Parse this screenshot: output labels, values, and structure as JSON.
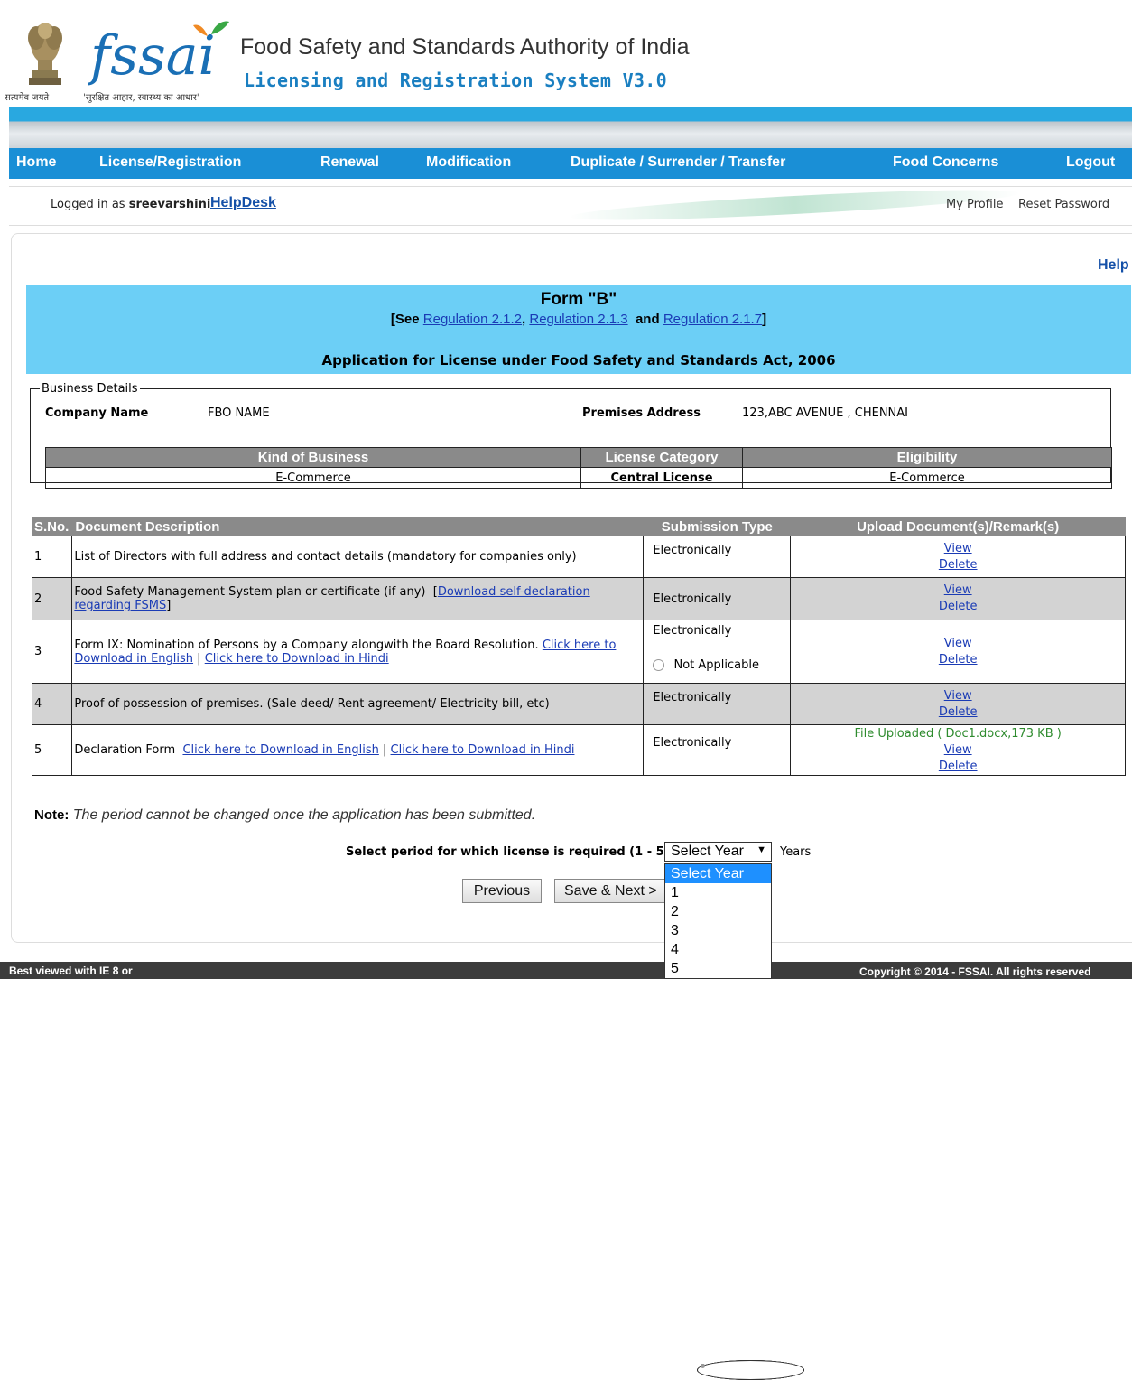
{
  "header": {
    "org_name": "Food Safety and Standards Authority of India",
    "system_name": "Licensing and Registration System V3.0",
    "emblem_caption": "सत्यमेव जयते",
    "logo_text": "fssai",
    "logo_tagline": "'सुरक्षित आहार, स्वास्थ्य का आधार'"
  },
  "nav": {
    "items": [
      "Home",
      "License/Registration",
      "Renewal",
      "Modification",
      "Duplicate / Surrender / Transfer",
      "Food Concerns",
      "Logout"
    ]
  },
  "subbar": {
    "logged_in_prefix": "Logged in as",
    "username": "sreevarshini",
    "helpdesk": "HelpDesk",
    "my_profile": "My Profile",
    "reset_password": "Reset Password"
  },
  "help_link": "Help",
  "form": {
    "title": "Form \"B\"",
    "see_prefix": "[See",
    "reg1": "Regulation 2.1.2",
    "comma": ",",
    "reg2": "Regulation 2.1.3",
    "and_text": "and",
    "reg3": "Regulation 2.1.7",
    "close_bracket": "]",
    "subtitle": "Application for License under Food Safety and Standards Act, 2006"
  },
  "business": {
    "legend": "Business Details",
    "company_name_label": "Company Name",
    "company_name": "FBO NAME",
    "premises_label": "Premises Address",
    "premises": "123,ABC AVENUE , CHENNAI",
    "table_headers": [
      "Kind of Business",
      "License Category",
      "Eligibility"
    ],
    "kind_of_business": "E-Commerce",
    "license_category": "Central License",
    "eligibility": "E-Commerce"
  },
  "documents": {
    "headers": [
      "S.No.",
      "Document Description",
      "Submission Type",
      "Upload Document(s)/Remark(s)"
    ],
    "electronically": "Electronically",
    "not_applicable": "Not Applicable",
    "view": "View",
    "delete": "Delete",
    "rows": [
      {
        "sno": "1",
        "desc": "List of Directors with full address and contact details (mandatory for companies only)"
      },
      {
        "sno": "2",
        "desc": "Food Safety Management System plan or certificate (if any)",
        "bracket_open": "[",
        "link": "Download self-declaration regarding FSMS",
        "bracket_close": "]"
      },
      {
        "sno": "3",
        "desc": "Form IX: Nomination of Persons by a Company alongwith the Board Resolution.",
        "link_en": "Click here to Download in English",
        "sep": "|",
        "link_hi": "Click here to Download in Hindi"
      },
      {
        "sno": "4",
        "desc": "Proof of possession of premises. (Sale deed/ Rent agreement/ Electricity bill, etc)"
      },
      {
        "sno": "5",
        "desc": "Declaration Form",
        "link_en": "Click here to Download in English",
        "sep": "|",
        "link_hi": "Click here to Download in Hindi",
        "uploaded": "File Uploaded ( Doc1.docx,173 KB )"
      }
    ]
  },
  "note": {
    "label": "Note:",
    "text": "The period cannot be changed once the application has been submitted."
  },
  "period": {
    "label": "Select period for which license is required (1 - 5)",
    "required_mark": "*",
    "selected": "Select Year",
    "options": [
      "Select Year",
      "1",
      "2",
      "3",
      "4",
      "5"
    ],
    "unit": "Years"
  },
  "buttons": {
    "previous": "Previous",
    "save_next": "Save & Next >"
  },
  "footer": {
    "left": "Best viewed with IE 8 or",
    "right": "Copyright © 2014 - FSSAI. All rights reserved"
  }
}
